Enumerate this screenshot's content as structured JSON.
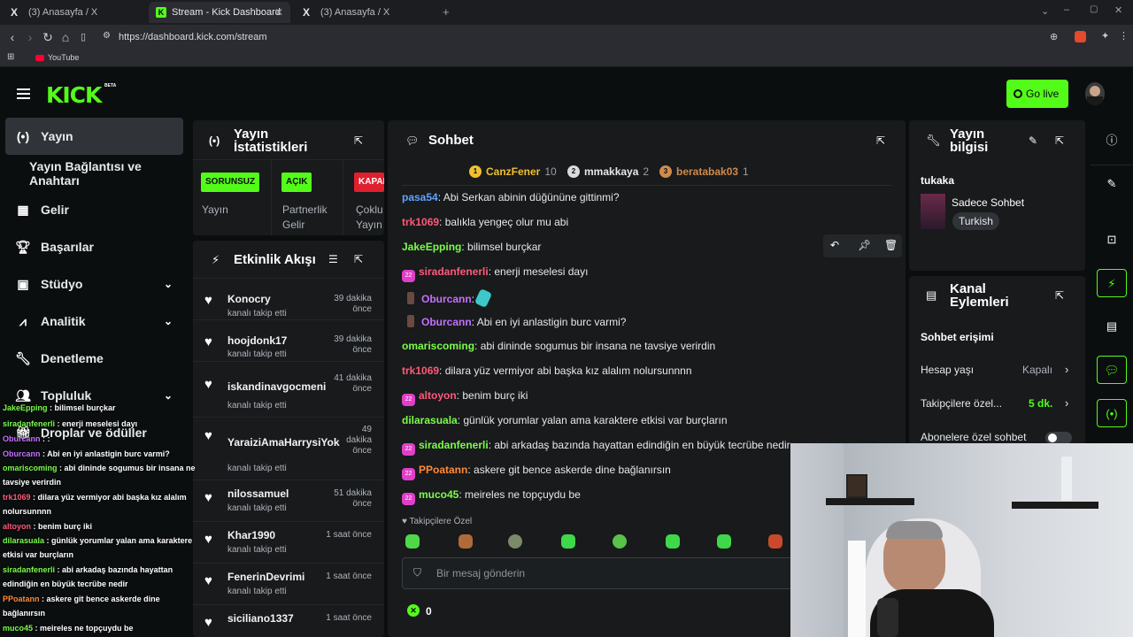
{
  "browser": {
    "tabs": [
      {
        "title": "(3) Anasayfa / X",
        "logo": "X"
      },
      {
        "title": "Stream - Kick Dashboard",
        "logo": "K"
      },
      {
        "title": "(3) Anasayfa / X",
        "logo": "X"
      }
    ],
    "url": "https://dashboard.kick.com/stream",
    "bookmark": "YouTube"
  },
  "header": {
    "logo": "KICK",
    "beta": "BETA",
    "go_live": "Go live"
  },
  "sidebar": {
    "items": [
      {
        "label": "Yayın",
        "icon": "broadcast-icon"
      },
      {
        "label": "Yayın Bağlantısı ve Anahtarı",
        "icon": ""
      },
      {
        "label": "Gelir",
        "icon": "grid-icon"
      },
      {
        "label": "Başarılar",
        "icon": "trophy-icon"
      },
      {
        "label": "Stüdyo",
        "icon": "studio-icon"
      },
      {
        "label": "Analitik",
        "icon": "analytics-icon"
      },
      {
        "label": "Denetleme",
        "icon": "wrench-icon"
      },
      {
        "label": "Topluluk",
        "icon": "community-icon"
      },
      {
        "label": "Droplar ve ödüller",
        "icon": "gift-icon"
      }
    ]
  },
  "stats": {
    "title_line1": "Yayın",
    "title_line2": "İstatistikleri",
    "badges": [
      "SORUNSUZ",
      "AÇIK",
      "KAPALI"
    ],
    "labels": [
      [
        "Yayın"
      ],
      [
        "Partnerlik",
        "Gelir"
      ],
      [
        "Çoklu",
        "Yayın"
      ]
    ],
    "colors": {
      "sorunsuz": "#53fc18",
      "acik": "#53fc18",
      "kapali": "#e0202f"
    }
  },
  "activity": {
    "title": "Etkinlik Akışı",
    "items": [
      {
        "user": "Konocry",
        "action": "kanalı takip etti",
        "time": "39 dakika önce"
      },
      {
        "user": "hoojdonk17",
        "action": "kanalı takip etti",
        "time": "39 dakika önce"
      },
      {
        "user": "iskandinavgocmeni",
        "action": "kanalı takip etti",
        "time": "41 dakika önce"
      },
      {
        "user": "YaraiziAmaHarrysiYok",
        "action": "kanalı takip etti",
        "time": "49 dakika önce"
      },
      {
        "user": "nilossamuel",
        "action": "kanalı takip etti",
        "time": "51 dakika önce"
      },
      {
        "user": "Khar1990",
        "action": "kanalı takip etti",
        "time": "1 saat önce"
      },
      {
        "user": "FenerinDevrimi",
        "action": "kanalı takip etti",
        "time": "1 saat önce"
      },
      {
        "user": "siciliano1337",
        "action": "",
        "time": "1 saat önce"
      }
    ]
  },
  "chat": {
    "title": "Sohbet",
    "top_gifters": [
      {
        "rank": "1",
        "name": "CanzFener",
        "count": "10"
      },
      {
        "rank": "2",
        "name": "mmakkaya",
        "count": "2"
      },
      {
        "rank": "3",
        "name": "beratabak03",
        "count": "1"
      }
    ],
    "messages": [
      {
        "user": "pasa54",
        "text": "Abi Serkan abinin düğününe gittinmi?",
        "color": "#5fa3ff",
        "badge": ""
      },
      {
        "user": "trk1069",
        "text": "balıkla yengeç olur mu abi",
        "color": "#ff5a78",
        "badge": ""
      },
      {
        "user": "JakeEpping",
        "text": "bilimsel burçkar",
        "color": "#7cfc4a",
        "badge": ""
      },
      {
        "user": "siradanfenerli",
        "text": "enerji meselesi dayı",
        "color": "#ff5a78",
        "badge": "sub"
      },
      {
        "user": "Oburcann",
        "text": "",
        "color": "#c470ff",
        "badge": "avatar"
      },
      {
        "user": "Oburcann",
        "text": "Abi en iyi anlastigin burc varmi?",
        "color": "#c470ff",
        "badge": "avatar"
      },
      {
        "user": "omariscoming",
        "text": "abi dininde sogumus bir insana ne tavsiye verirdin",
        "color": "#7cfc4a",
        "badge": ""
      },
      {
        "user": "trk1069",
        "text": "dilara yüz vermiyor abi başka kız alalım nolursunnnn",
        "color": "#ff5a78",
        "badge": ""
      },
      {
        "user": "altoyon",
        "text": "benim burç iki",
        "color": "#ff5a78",
        "badge": "sub"
      },
      {
        "user": "dilarasuala",
        "text": "günlük yorumlar yalan ama karaktere etkisi var burçların",
        "color": "#7cfc4a",
        "badge": ""
      },
      {
        "user": "siradanfenerli",
        "text": "abi arkadaş bazında hayattan edindiğin en büyük tecrübe nedir",
        "color": "#7cfc4a",
        "badge": "sub"
      },
      {
        "user": "PPoatann",
        "text": "askere git bence askerde dine bağlanırsın",
        "color": "#ff8a3a",
        "badge": "sub"
      },
      {
        "user": "muco45",
        "text": "meireles ne topçuydu be",
        "color": "#7cfc4a",
        "badge": "sub"
      }
    ],
    "followers_only": "Takipçilere Özel",
    "input_placeholder": "Bir mesaj gönderin",
    "points": "0"
  },
  "stream_info": {
    "title_line1": "Yayın",
    "title_line2": "bilgisi",
    "stream_title": "tukaka",
    "category": "Sadece Sohbet",
    "language": "Turkish"
  },
  "channel_actions": {
    "title_line1": "Kanal",
    "title_line2": "Eylemleri",
    "section": "Sohbet erişimi",
    "rows": [
      {
        "label": "Hesap yaşı",
        "value": "Kapalı"
      },
      {
        "label": "Takipçilere özel...",
        "value": "5 dk."
      },
      {
        "label": "Abonelere özel sohbet",
        "value": ""
      }
    ]
  },
  "overlay_chat": [
    {
      "user": "JakeEpping",
      "text": "bilimsel burçkar",
      "color": "#7cfc4a"
    },
    {
      "user": "siradanfenerli",
      "text": "enerji meselesi dayı",
      "color": "#7cfc4a"
    },
    {
      "user": "Oburcann",
      "text": ":",
      "color": "#c470ff"
    },
    {
      "user": "Oburcann",
      "text": "Abi en iyi anlastigin burc varmi?",
      "color": "#c470ff"
    },
    {
      "user": "omariscoming",
      "text": "abi dininde sogumus bir insana ne tavsiye verirdin",
      "color": "#7cfc4a"
    },
    {
      "user": "trk1069",
      "text": "dilara yüz vermiyor abi başka kız alalım nolursunnnn",
      "color": "#ff5a78"
    },
    {
      "user": "altoyon",
      "text": "benim burç iki",
      "color": "#ff5a78"
    },
    {
      "user": "dilarasuala",
      "text": "günlük yorumlar yalan ama karaktere etkisi var burçların",
      "color": "#7cfc4a"
    },
    {
      "user": "siradanfenerli",
      "text": "abi arkadaş bazında hayattan edindiğin en büyük tecrübe nedir",
      "color": "#7cfc4a"
    },
    {
      "user": "PPoatann",
      "text": "askere git bence askerde dine bağlanırsın",
      "color": "#ff8a3a"
    },
    {
      "user": "muco45",
      "text": "meireles ne topçuydu be",
      "color": "#7cfc4a"
    }
  ],
  "colors": {
    "accent": "#53fc18",
    "panel": "#181a1c",
    "background": "#0b0e0f"
  }
}
